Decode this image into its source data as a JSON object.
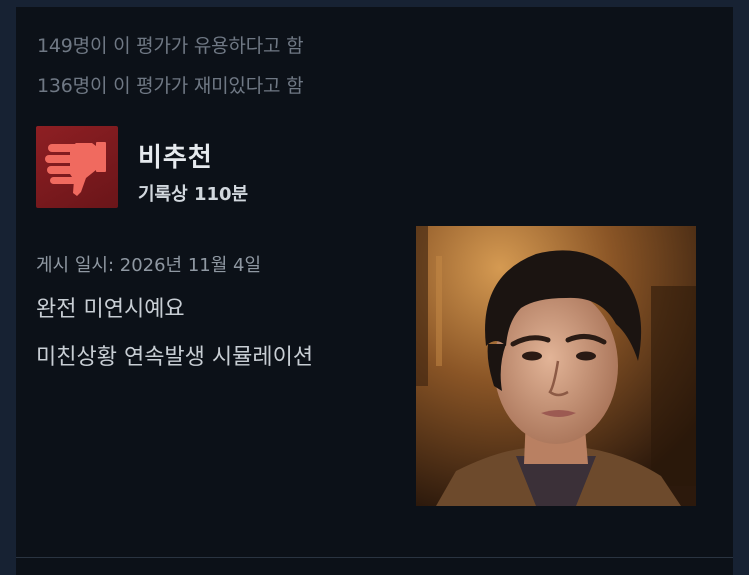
{
  "review": {
    "helpful_line": "149명이 이 평가가 유용하다고 함",
    "funny_line": "136명이 이 평가가 재미있다고 함",
    "verdict": "비추천",
    "hours_on_record": "기록상 110분",
    "posted_date": "게시 일시: 2026년 11월 4일",
    "body_lines": [
      "완전 미연시예요",
      "미친상황 연속발생 시뮬레이션"
    ],
    "thumb_icon": "thumbs-down-icon"
  },
  "colors": {
    "page_background": "#172233",
    "card_background": "#0c1118",
    "thumb_box": "#8e1f23",
    "thumb_glyph": "#f06a5f"
  }
}
